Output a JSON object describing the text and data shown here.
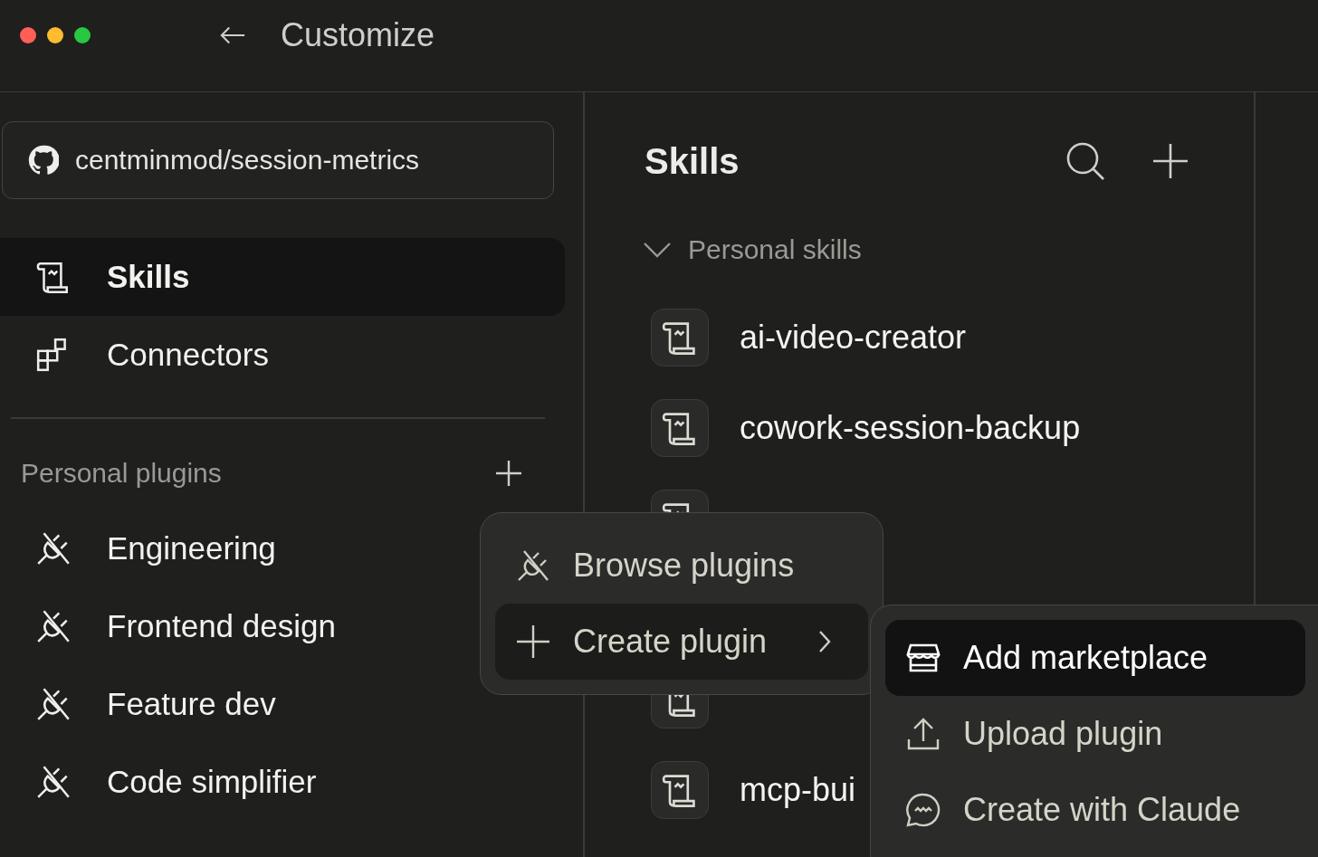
{
  "window": {
    "title": "Customize"
  },
  "sidebar": {
    "repo": "centminmod/session-metrics",
    "nav": [
      {
        "label": "Skills",
        "kind": "scroll",
        "selected": true
      },
      {
        "label": "Connectors",
        "kind": "blocks",
        "selected": false
      }
    ],
    "plugins_heading": "Personal plugins",
    "plugins": [
      {
        "label": "Engineering"
      },
      {
        "label": "Frontend design"
      },
      {
        "label": "Feature dev"
      },
      {
        "label": "Code simplifier"
      }
    ]
  },
  "skills": {
    "title": "Skills",
    "group": {
      "label": "Personal skills",
      "expanded": true
    },
    "items": [
      {
        "name": "ai-video-creator"
      },
      {
        "name": "cowork-session-backup"
      },
      {
        "kind": "covered"
      },
      {
        "kind": "hidden"
      },
      {
        "kind": "covered"
      },
      {
        "name": "mcp-bui"
      }
    ]
  },
  "plugin_menu": [
    {
      "label": "Browse plugins",
      "kind": "plug",
      "submenu": false,
      "selected": false
    },
    {
      "label": "Create plugin",
      "kind": "plus",
      "submenu": true,
      "selected": true
    }
  ],
  "create_submenu": [
    {
      "label": "Add marketplace",
      "kind": "store",
      "selected": true
    },
    {
      "label": "Upload plugin",
      "kind": "upload",
      "selected": false
    },
    {
      "label": "Create with Claude",
      "kind": "chat",
      "selected": false
    }
  ]
}
